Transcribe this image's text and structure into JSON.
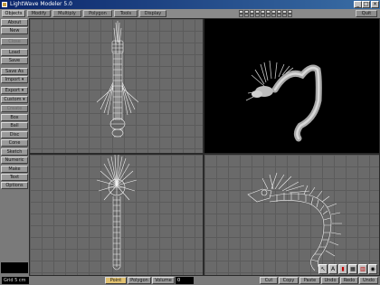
{
  "window": {
    "title": "LightWave Modeler 5.0",
    "min": "_",
    "max": "□",
    "close": "×"
  },
  "tabs": [
    {
      "label": "Objects",
      "active": true
    },
    {
      "label": "Modify",
      "active": false
    },
    {
      "label": "Multiply",
      "active": false
    },
    {
      "label": "Polygon",
      "active": false
    },
    {
      "label": "Tools",
      "active": false
    },
    {
      "label": "Display",
      "active": false
    }
  ],
  "quit_label": "Quit",
  "sidebar": [
    {
      "label": "About",
      "enabled": true
    },
    {
      "label": "New",
      "enabled": true
    },
    {
      "label": "Close",
      "enabled": false
    },
    {
      "label": "Load",
      "enabled": true
    },
    {
      "label": "Save",
      "enabled": true
    },
    {
      "label": "Save As",
      "enabled": true
    },
    {
      "label": "Import ▾",
      "enabled": true
    },
    {
      "label": "Export ▾",
      "enabled": true
    },
    {
      "label": "Custom ▾",
      "enabled": true
    },
    {
      "label": "Create",
      "enabled": false
    },
    {
      "label": "Box",
      "enabled": true
    },
    {
      "label": "Ball",
      "enabled": true
    },
    {
      "label": "Disc",
      "enabled": true
    },
    {
      "label": "Cone",
      "enabled": true
    },
    {
      "label": "Sketch",
      "enabled": true
    },
    {
      "label": "Numeric",
      "enabled": true
    },
    {
      "label": "Make",
      "enabled": true
    },
    {
      "label": "Text",
      "enabled": true
    },
    {
      "label": "Options",
      "enabled": true
    }
  ],
  "bottombar": {
    "grid": "Grid  5 cm",
    "modes": [
      "Point",
      "Polygon",
      "Volume"
    ],
    "selected_mode": "Point",
    "value": "0",
    "actions": [
      "Cut",
      "Copy",
      "Paste",
      "Undo",
      "Redo",
      "Undo"
    ]
  },
  "colors": {
    "accent": "#0a246a",
    "selected_mode": "#e0c070",
    "viewport_bg": "#6a6a6a"
  },
  "icons": [
    "arrow-icon",
    "text-A-icon",
    "red-item-icon",
    "layout-grid-icon",
    "red-bars-icon",
    "camera-icon"
  ]
}
